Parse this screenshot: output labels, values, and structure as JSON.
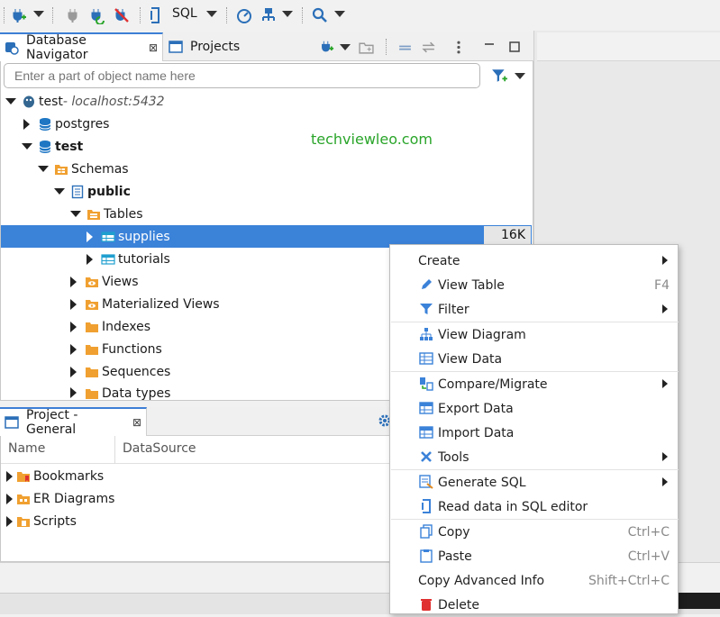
{
  "toolbar": {
    "sql_label": "SQL"
  },
  "navigator": {
    "tab_label": "Database Navigator",
    "projects_tab_label": "Projects",
    "search_placeholder": "Enter a part of object name here",
    "tree": {
      "connection": "test",
      "connection_host": " - localhost:5432",
      "db_postgres": "postgres",
      "db_test": "test",
      "schemas": "Schemas",
      "schema_public": "public",
      "tables": "Tables",
      "table_supplies": "supplies",
      "table_supplies_size": "16K",
      "table_tutorials": "tutorials",
      "views": "Views",
      "mat_views": "Materialized Views",
      "indexes": "Indexes",
      "functions": "Functions",
      "sequences": "Sequences",
      "data_types": "Data types"
    },
    "watermark": "techviewleo.com"
  },
  "project": {
    "tab_label": "Project - General",
    "columns": [
      "Name",
      "DataSource"
    ],
    "items": [
      "Bookmarks",
      "ER Diagrams",
      "Scripts"
    ]
  },
  "context_menu": {
    "items": [
      {
        "label": "Create",
        "accel": "",
        "submenu": true
      },
      {
        "label": "View Table",
        "accel": "F4",
        "submenu": false
      },
      {
        "label": "Filter",
        "accel": "",
        "submenu": true
      },
      {
        "label": "View Diagram",
        "accel": "",
        "submenu": false
      },
      {
        "label": "View Data",
        "accel": "",
        "submenu": false
      },
      {
        "label": "Compare/Migrate",
        "accel": "",
        "submenu": true
      },
      {
        "label": "Export Data",
        "accel": "",
        "submenu": false
      },
      {
        "label": "Import Data",
        "accel": "",
        "submenu": false
      },
      {
        "label": "Tools",
        "accel": "",
        "submenu": true
      },
      {
        "label": "Generate SQL",
        "accel": "",
        "submenu": true
      },
      {
        "label": "Read data in SQL editor",
        "accel": "",
        "submenu": false
      },
      {
        "label": "Copy",
        "accel": "Ctrl+C",
        "submenu": false
      },
      {
        "label": "Paste",
        "accel": "Ctrl+V",
        "submenu": false
      },
      {
        "label": "Copy Advanced Info",
        "accel": "Shift+Ctrl+C",
        "submenu": false
      },
      {
        "label": "Delete",
        "accel": "",
        "submenu": false
      }
    ]
  },
  "colors": {
    "accent": "#3b82d9",
    "folder": "#f0a030",
    "watermark": "#2aa52a",
    "db_blue": "#1f77c4",
    "delete_red": "#e03030"
  }
}
